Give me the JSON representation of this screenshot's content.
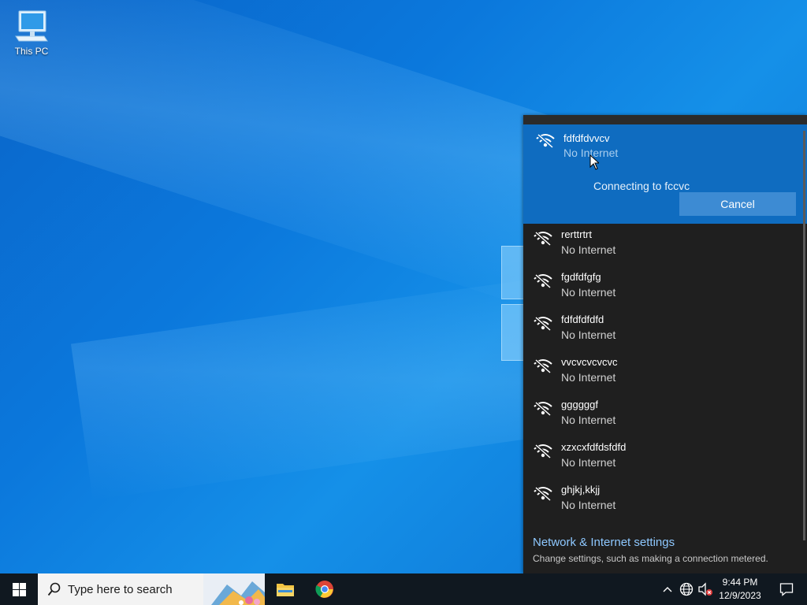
{
  "desktop": {
    "icons": [
      {
        "label": "This PC",
        "icon": "computer-icon"
      }
    ]
  },
  "flyout": {
    "active_network": {
      "name": "fdfdfdvvcv",
      "status": "No Internet",
      "connecting_text": "Connecting to fccvc",
      "cancel_label": "Cancel"
    },
    "networks": [
      {
        "name": "rerttrtrt",
        "status": "No Internet"
      },
      {
        "name": "fgdfdfgfg",
        "status": "No Internet"
      },
      {
        "name": "fdfdfdfdfd",
        "status": "No Internet"
      },
      {
        "name": "vvcvcvcvcvc",
        "status": "No Internet"
      },
      {
        "name": "ggggggf",
        "status": "No Internet"
      },
      {
        "name": "xzxcxfdfdsfdfd",
        "status": "No Internet"
      },
      {
        "name": "ghjkj,kkjj",
        "status": "No Internet"
      }
    ],
    "settings_link": "Network & Internet settings",
    "settings_desc": "Change settings, such as making a connection metered."
  },
  "taskbar": {
    "search_placeholder": "Type here to search",
    "apps": [
      {
        "name": "File Explorer",
        "icon": "folder-icon"
      },
      {
        "name": "Google Chrome",
        "icon": "chrome-icon"
      }
    ],
    "clock": {
      "time": "9:44 PM",
      "date": "12/9/2023"
    }
  },
  "colors": {
    "flyout_bg": "#1f1f1f",
    "active_bg": "#0f6cc0",
    "accent_link": "#8ec8ff",
    "taskbar_bg": "#101820"
  }
}
